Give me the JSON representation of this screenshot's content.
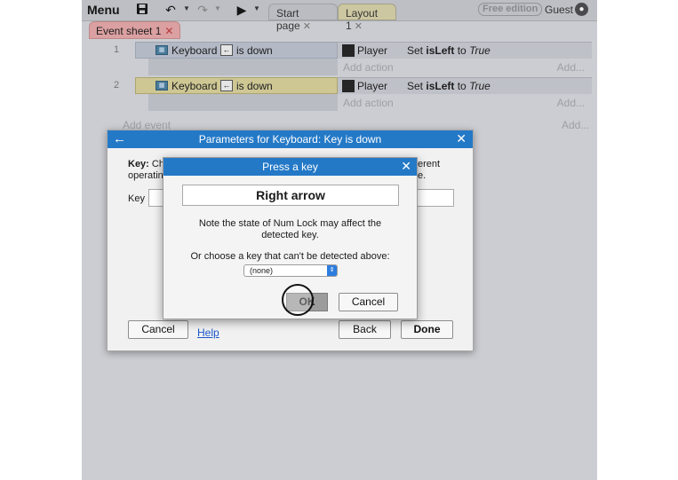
{
  "toolbar": {
    "menu_label": "Menu",
    "icons": [
      "save-icon",
      "undo-icon",
      "redo-icon",
      "play-icon"
    ],
    "tabs": [
      {
        "label": "Start page",
        "close": "✕"
      },
      {
        "label": "Layout 1",
        "close": "✕"
      }
    ],
    "edition_badge": "Free edition",
    "user_label": "Guest"
  },
  "sheet_tab": {
    "label": "Event sheet 1",
    "close": "✕"
  },
  "events": [
    {
      "number": "1",
      "object": "Keyboard",
      "key_glyph": "←",
      "condition": "is down",
      "action_object": "Player",
      "action_prefix": "Set ",
      "action_var": "isLeft",
      "action_mid": " to ",
      "action_value": "True",
      "add_action": "Add action",
      "add_action_right": "Add..."
    },
    {
      "number": "2",
      "object": "Keyboard",
      "key_glyph": "←",
      "condition": "is down",
      "action_object": "Player",
      "action_prefix": "Set ",
      "action_var": "isLeft",
      "action_mid": " to ",
      "action_value": "True",
      "add_action": "Add action",
      "add_action_right": "Add..."
    }
  ],
  "add_event": "Add event",
  "add_event_right": "Add...",
  "params_dialog": {
    "back": "←",
    "title": "Parameters for Keyboard: Key is down",
    "close": "✕",
    "desc_lead": "Key:",
    "desc_line1_left": " Ch",
    "desc_line2_left": "operatin",
    "desc_line1_right": "erent",
    "desc_line2_right": "e.",
    "key_label": "Key",
    "cancel": "Cancel",
    "help": "Help",
    "back_button": "Back",
    "done": "Done"
  },
  "press_key_dialog": {
    "title": "Press a key",
    "close": "✕",
    "detected_key": "Right arrow",
    "note_line1": "Note the state of Num Lock may affect the",
    "note_line2": "detected key.",
    "choose_label": "Or choose a key that can't be detected above:",
    "select_value": "(none)",
    "ok": "OK",
    "cancel": "Cancel"
  }
}
